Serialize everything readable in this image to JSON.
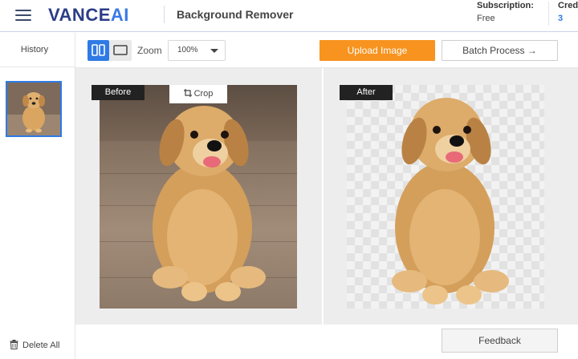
{
  "header": {
    "brand_main": "VANCE",
    "brand_ai": "AI",
    "product": "Background Remover",
    "subscription_label": "Subscription:",
    "subscription_value": "Free",
    "credits_label": "Credits:",
    "credits_value": "3"
  },
  "sidebar": {
    "title": "History",
    "delete_all": "Delete All"
  },
  "toolbar": {
    "zoom_label": "Zoom",
    "zoom_value": "100%",
    "upload_label": "Upload Image",
    "batch_label": "Batch Process →"
  },
  "workspace": {
    "before_label": "Before",
    "after_label": "After",
    "crop_label": "Crop"
  },
  "footer": {
    "feedback_label": "Feedback"
  },
  "colors": {
    "accent": "#2f7ae5",
    "brand": "#2b3d88",
    "upload": "#f7931e"
  }
}
